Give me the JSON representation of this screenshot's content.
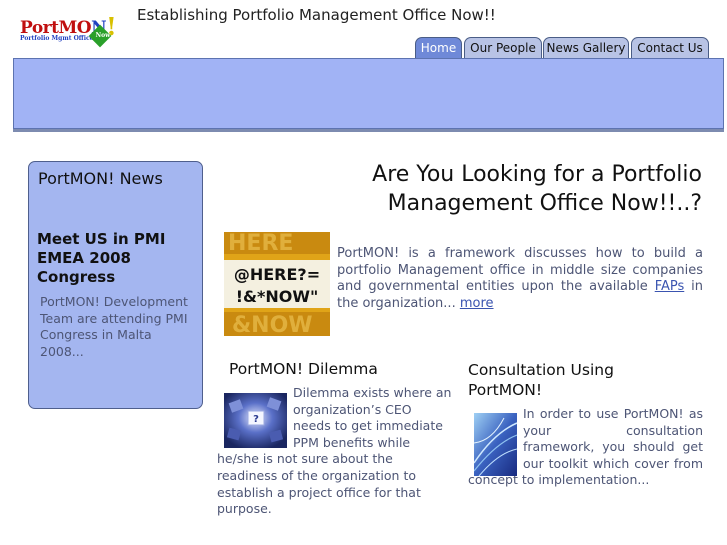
{
  "header": {
    "logo_text_a": "PortMO",
    "logo_text_b": "N",
    "logo_text_c": "!",
    "logo_sub": "Portfolio Mgmt Office",
    "logo_badge": "Now",
    "tagline": "Establishing Portfolio Management Office Now!!"
  },
  "nav": {
    "tabs": [
      {
        "label": "Home",
        "active": true
      },
      {
        "label": "Our People",
        "active": false
      },
      {
        "label": "News Gallery",
        "active": false
      },
      {
        "label": "Contact Us",
        "active": false
      }
    ]
  },
  "sidebar": {
    "title": "PortMON! News",
    "headline": "Meet US in PMI EMEA 2008 Congress",
    "body": "PortMON! Development Team are attending PMI Congress in Malta 2008..."
  },
  "main": {
    "heading": "Are You Looking for a Portfolio Management Office Now!!..?",
    "intro_text": "PortMON! is a framework discusses how to build a portfolio Management office in middle size companies and governmental entities upon the available",
    "intro_link": "FAPs",
    "intro_tail": "in the organization...",
    "more_link": "more",
    "image_text_1": "@HERE?=",
    "image_text_2": "!&*NOW\""
  },
  "dilemma": {
    "title": "PortMON! Dilemma",
    "text": "Dilemma exists where an organization’s CEO needs to get immediate PPM benefits while he/she is not sure about the readiness of the organization to establish a project office for that purpose."
  },
  "consultation": {
    "title": "Consultation Using PortMON!",
    "text": "In order to use PortMON! as your consultation framework, you should get our toolkit which cover from concept to implementation..."
  },
  "colors": {
    "banner": "#a1b3f5",
    "tab_active": "#6f89d8",
    "tab_inactive": "#b8c3e5",
    "news_box": "#a4b6f0",
    "body_text": "#4d5575"
  }
}
